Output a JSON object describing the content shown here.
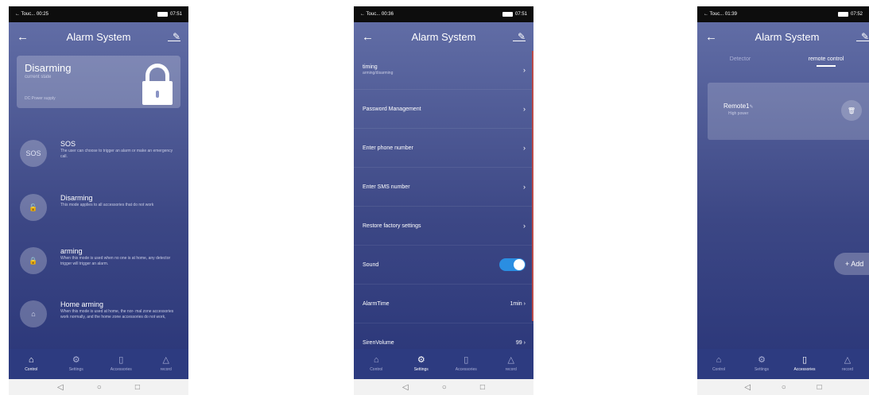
{
  "screens": [
    {
      "status": {
        "app": "← Touc... 00:25",
        "time": "07:51"
      },
      "title": "Alarm System",
      "state": {
        "title": "Disarming",
        "subtitle": "current state",
        "power": "DC:Power supply"
      },
      "modes": [
        {
          "icon": "sos-icon",
          "icon_text": "SOS",
          "title": "SOS",
          "desc": "The user can choose to trigger an alarm or make an emergency call."
        },
        {
          "icon": "unlock-icon",
          "title": "Disarming",
          "desc": "This mode applies to all accessories that do not work"
        },
        {
          "icon": "lock-icon",
          "title": "arming",
          "desc": "When this mode is used when no one is at home, any detector trigger will trigger an alarm."
        },
        {
          "icon": "home-icon",
          "title": "Home arming",
          "desc": "When this mode is used at home, the nor- mal zone accessories work normally, and the home zone accessories do not work,"
        }
      ],
      "nav": [
        {
          "label": "Control",
          "active": true
        },
        {
          "label": "Settings",
          "active": false
        },
        {
          "label": "Accessories",
          "active": false
        },
        {
          "label": "record",
          "active": false
        }
      ]
    },
    {
      "status": {
        "app": "← Touc... 00:36",
        "time": "07:51"
      },
      "title": "Alarm System",
      "rows": [
        {
          "label": "timing",
          "sub": "arming/disarming"
        },
        {
          "label": "Password Management"
        },
        {
          "label": "Enter phone number"
        },
        {
          "label": "Enter SMS number"
        },
        {
          "label": "Restore factory settings"
        },
        {
          "label": "Sound",
          "toggle_on": true
        },
        {
          "label": "AlarmTime",
          "value": "1min"
        },
        {
          "label": "SirenVolume",
          "value": "99"
        }
      ],
      "nav": [
        {
          "label": "Control",
          "active": false
        },
        {
          "label": "Settings",
          "active": true
        },
        {
          "label": "Accessories",
          "active": false
        },
        {
          "label": "record",
          "active": false
        }
      ]
    },
    {
      "status": {
        "app": "← Touc... 01:39",
        "time": "07:52"
      },
      "title": "Alarm System",
      "tabs": [
        "Detector",
        "remote control"
      ],
      "remote": {
        "name": "Remote1",
        "power": "High power"
      },
      "add_label": "+ Add",
      "nav": [
        {
          "label": "Control",
          "active": false
        },
        {
          "label": "Settings",
          "active": false
        },
        {
          "label": "Accessories",
          "active": true
        },
        {
          "label": "record",
          "active": false
        }
      ]
    }
  ],
  "nav_icons": [
    "home-icon",
    "gear-icon",
    "accessories-icon",
    "warning-icon"
  ],
  "colors": {
    "toggle_on": "#2a8ee2",
    "nav_bg": "#2d3b80"
  }
}
